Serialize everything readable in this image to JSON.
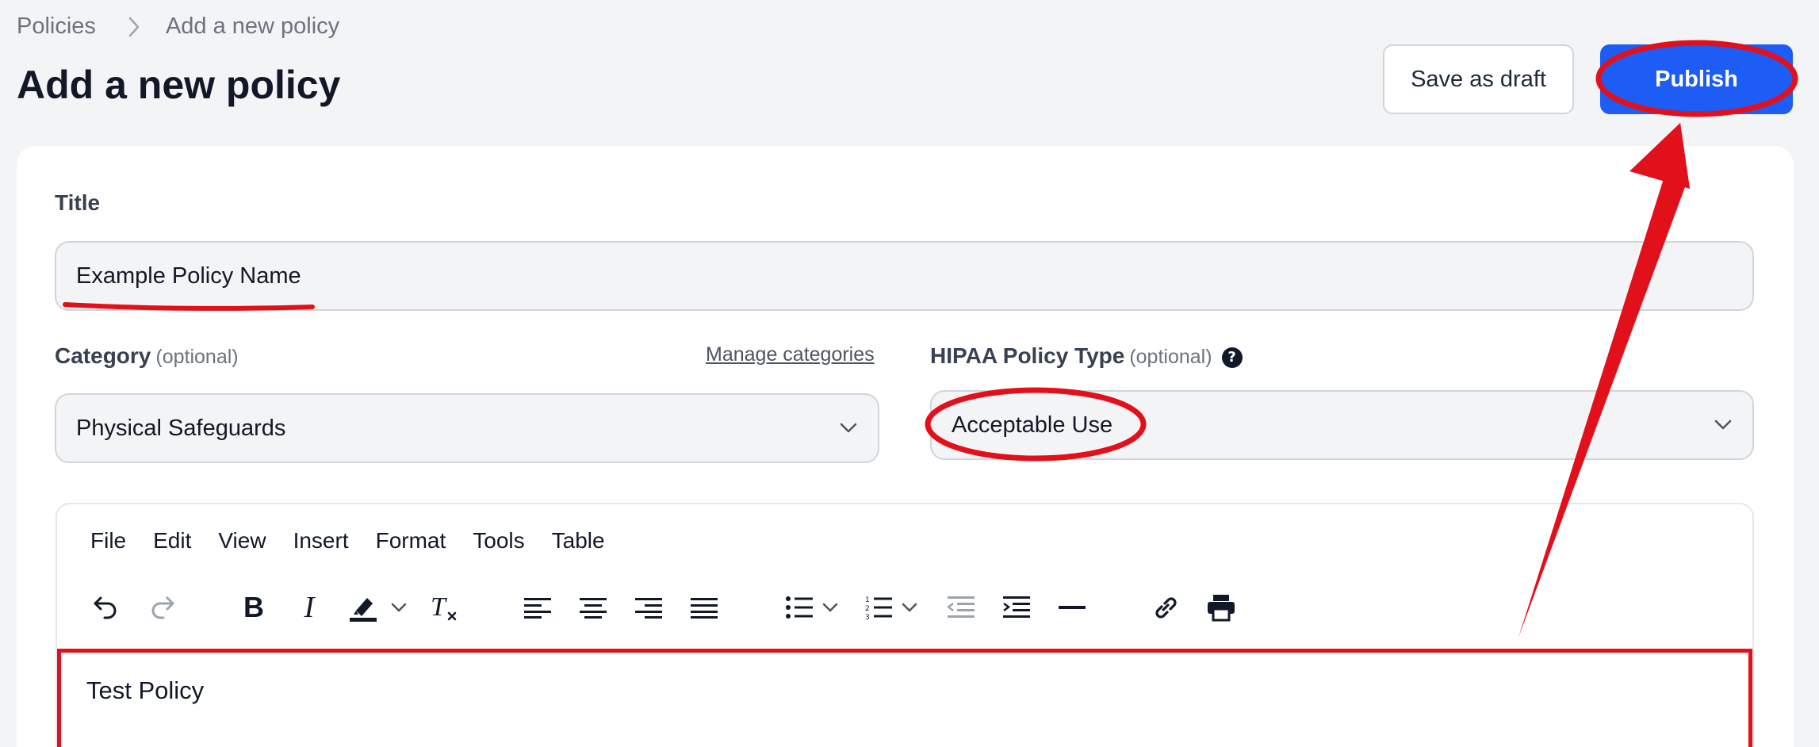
{
  "breadcrumb": {
    "root": "Policies",
    "current": "Add a new policy"
  },
  "page": {
    "title": "Add a new policy"
  },
  "actions": {
    "draft_label": "Save as draft",
    "publish_label": "Publish"
  },
  "form": {
    "title_label": "Title",
    "title_value": "Example Policy Name",
    "category_label": "Category",
    "category_optional": "(optional)",
    "manage_categories": "Manage categories",
    "category_value": "Physical Safeguards",
    "hipaa_label": "HIPAA Policy Type",
    "hipaa_optional": "(optional)",
    "hipaa_value": "Acceptable Use"
  },
  "editor": {
    "menus": [
      "File",
      "Edit",
      "View",
      "Insert",
      "Format",
      "Tools",
      "Table"
    ],
    "toolbar_icons": [
      "undo-icon",
      "redo-icon",
      "bold-icon",
      "italic-icon",
      "highlight-icon",
      "clear-formatting-icon",
      "align-left-icon",
      "align-center-icon",
      "align-right-icon",
      "justify-icon",
      "bullet-list-icon",
      "numbered-list-icon",
      "outdent-icon",
      "indent-icon",
      "horizontal-rule-icon",
      "link-icon",
      "print-icon"
    ],
    "content": "Test Policy"
  },
  "colors": {
    "primary": "#1d5cf5",
    "annotation": "#e2101a",
    "page_bg": "#f3f4f6"
  }
}
